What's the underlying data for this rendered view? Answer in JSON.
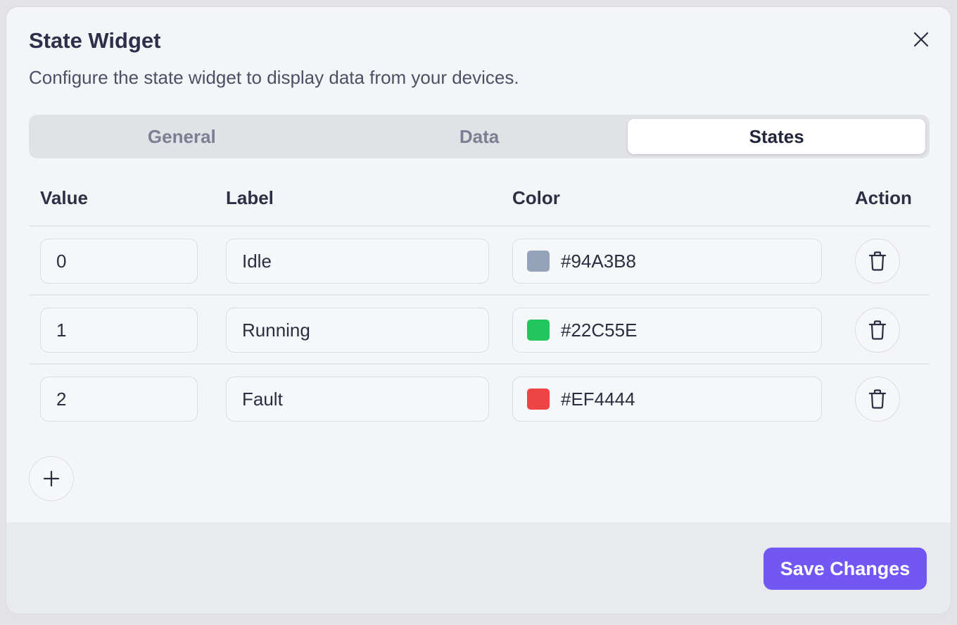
{
  "dialog": {
    "title": "State Widget",
    "subtitle": "Configure the state widget to display data from your devices.",
    "close_icon": "close-icon"
  },
  "tabs": [
    {
      "label": "General",
      "active": false
    },
    {
      "label": "Data",
      "active": false
    },
    {
      "label": "States",
      "active": true
    }
  ],
  "table": {
    "headers": {
      "value": "Value",
      "label": "Label",
      "color": "Color",
      "action": "Action"
    },
    "rows": [
      {
        "value": "0",
        "label": "Idle",
        "color": "#94A3B8"
      },
      {
        "value": "1",
        "label": "Running",
        "color": "#22C55E"
      },
      {
        "value": "2",
        "label": "Fault",
        "color": "#EF4444"
      }
    ],
    "delete_icon": "trash-icon"
  },
  "add_button_icon": "plus-icon",
  "footer": {
    "save_label": "Save Changes"
  },
  "colors": {
    "accent": "#7257F5",
    "background": "#F4F5F7"
  }
}
